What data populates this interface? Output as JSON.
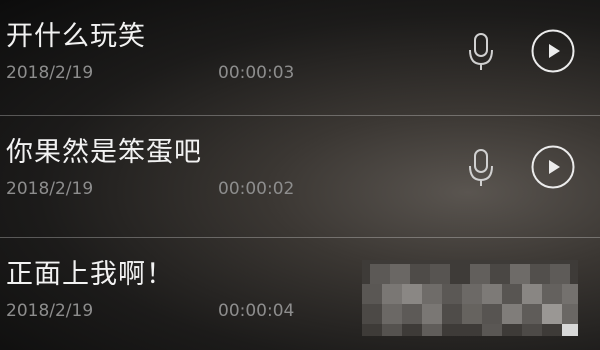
{
  "recordings": [
    {
      "title": "开什么玩笑",
      "date": "2018/2/19",
      "duration": "00:00:03",
      "mic_icon": "mic-icon",
      "play_icon": "play-icon"
    },
    {
      "title": "你果然是笨蛋吧",
      "date": "2018/2/19",
      "duration": "00:00:02",
      "mic_icon": "mic-icon",
      "play_icon": "play-icon"
    },
    {
      "title": "正面上我啊！",
      "date": "2018/2/19",
      "duration": "00:00:04",
      "obscured": true
    }
  ],
  "colors": {
    "title_text": "#f2f2f2",
    "meta_text": "#8d8d8d",
    "icon": "#e8e8e8",
    "divider": "#5c5c5c"
  }
}
